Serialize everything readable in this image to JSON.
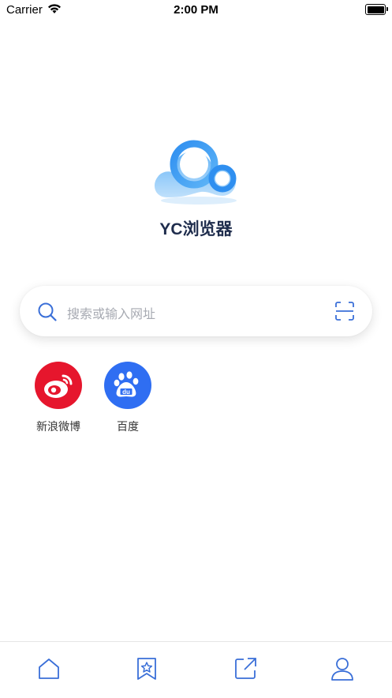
{
  "status_bar": {
    "carrier": "Carrier",
    "time": "2:00 PM"
  },
  "app": {
    "title": "YC浏览器"
  },
  "search": {
    "placeholder": "搜索或输入网址"
  },
  "shortcuts": [
    {
      "label": "新浪微博",
      "icon": "weibo-icon",
      "color": "#e6162d"
    },
    {
      "label": "百度",
      "icon": "baidu-paw-icon",
      "color": "#2f6ef2"
    }
  ],
  "tabbar": {
    "icons": [
      "home-icon",
      "bookmark-star-icon",
      "open-external-icon",
      "user-icon"
    ],
    "color": "#3a6fd8"
  },
  "colors": {
    "accent": "#3a6fd8",
    "logo_blue": "#3f9cf0"
  }
}
